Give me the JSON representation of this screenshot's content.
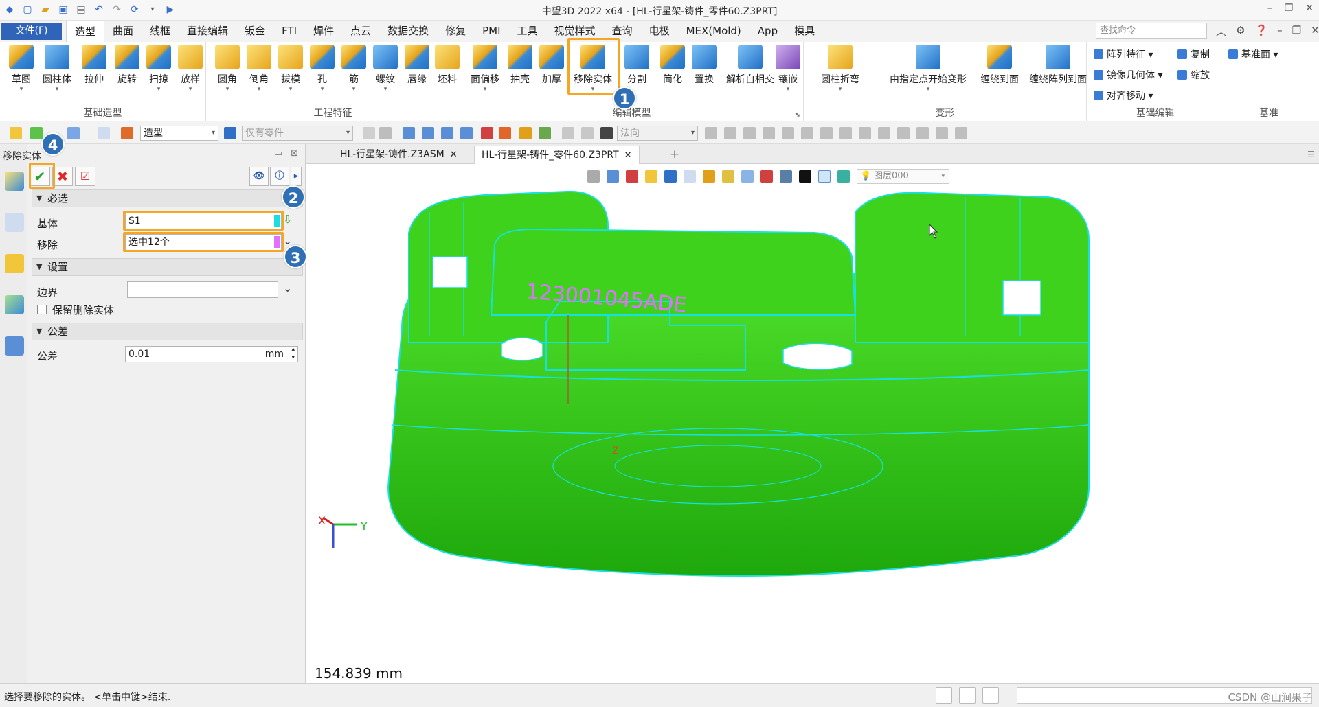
{
  "window": {
    "title": "中望3D 2022 x64 - [HL-行星架-铸件_零件60.Z3PRT]",
    "controls": [
      "–",
      "❐",
      "✕"
    ]
  },
  "menu": {
    "file": "文件(F)",
    "tabs": [
      "造型",
      "曲面",
      "线框",
      "直接编辑",
      "钣金",
      "FTI",
      "焊件",
      "点云",
      "数据交换",
      "修复",
      "PMI",
      "工具",
      "视觉样式",
      "查询",
      "电极",
      "MEX(Mold)",
      "App",
      "模具"
    ],
    "active_tab": "造型",
    "search_placeholder": "查找命令"
  },
  "ribbon": {
    "groups": [
      {
        "label": "基础造型",
        "buttons": [
          "草图",
          "圆柱体",
          "拉伸",
          "旋转",
          "扫掠",
          "放样"
        ]
      },
      {
        "label": "工程特征",
        "buttons": [
          "圆角",
          "倒角",
          "拔模",
          "孔",
          "筋",
          "螺纹",
          "唇缘",
          "坯料"
        ]
      },
      {
        "label": "编辑模型",
        "buttons": [
          "面偏移",
          "抽壳",
          "加厚",
          "移除实体",
          "分割",
          "简化",
          "置换",
          "解析自相交",
          "镶嵌"
        ]
      },
      {
        "label": "变形",
        "buttons": [
          "圆柱折弯",
          "由指定点开始变形",
          "缠绕到面",
          "缠绕阵列到面"
        ]
      },
      {
        "label": "基础编辑",
        "items": [
          "阵列特征",
          "镜像几何体",
          "对齐移动",
          "复制",
          "缩放"
        ]
      },
      {
        "label": "基准",
        "items": [
          "基准面"
        ]
      }
    ]
  },
  "toolbar2": {
    "mode_combo": "造型",
    "filter_combo": "仅有零件",
    "normal_combo": "法向"
  },
  "panel": {
    "title": "移除实体",
    "sections": {
      "required": "必选",
      "settings": "设置",
      "tolerance": "公差"
    },
    "fields": {
      "base_label": "基体",
      "base_value": "S1",
      "remove_label": "移除",
      "remove_value": "选中12个",
      "boundary_label": "边界",
      "boundary_value": "",
      "keep_label": "保留删除实体",
      "tolerance_label": "公差",
      "tolerance_value": "0.01",
      "tolerance_unit": "mm"
    }
  },
  "annotations": [
    "1",
    "2",
    "3",
    "4"
  ],
  "doc_tabs": [
    {
      "label": "HL-行星架-铸件.Z3ASM"
    },
    {
      "label": "HL-行星架-铸件_零件60.Z3PRT"
    }
  ],
  "viewport": {
    "layer": "图层000",
    "engraving": "123001045ADE",
    "scale": "154.839 mm",
    "axes": {
      "x": "X",
      "y": "Y",
      "z": "Z"
    },
    "colors": {
      "part": "#33d11a",
      "edges": "#19e0e0",
      "engraving": "#e070ff"
    }
  },
  "status": {
    "message": "选择要移除的实体。 <单击中键>结束.",
    "watermark": "CSDN @山涧果子"
  }
}
